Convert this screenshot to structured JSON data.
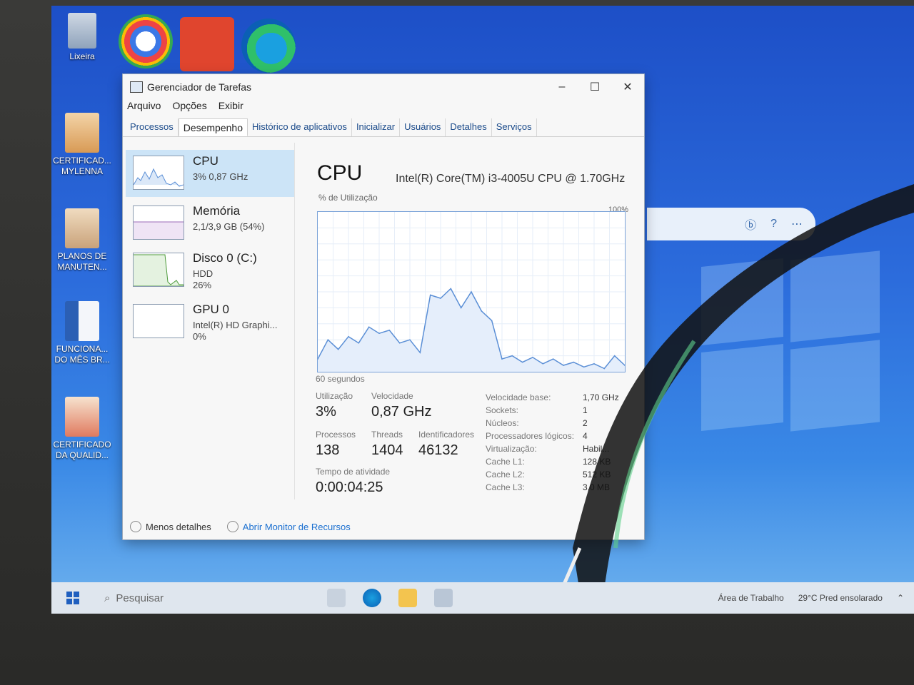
{
  "desktop": {
    "top_icon_labels": [
      "Lixeira"
    ],
    "icons": [
      {
        "label": "CERTIFICAD... MYLENNA"
      },
      {
        "label": "PLANOS DE MANUTEN..."
      },
      {
        "label": "FUNCIONA... DO MÊS BR..."
      },
      {
        "label": "CERTIFICADO DA QUALID..."
      }
    ]
  },
  "window": {
    "title": "Gerenciador de Tarefas",
    "controls": {
      "minimize": "–",
      "maximize": "☐",
      "close": "✕"
    },
    "menu": [
      "Arquivo",
      "Opções",
      "Exibir"
    ],
    "tabs": [
      "Processos",
      "Desempenho",
      "Histórico de aplicativos",
      "Inicializar",
      "Usuários",
      "Detalhes",
      "Serviços"
    ],
    "active_tab": "Desempenho"
  },
  "perf_items": [
    {
      "name": "CPU",
      "line1": "3% 0,87 GHz",
      "line2": "",
      "line3": ""
    },
    {
      "name": "Memória",
      "line1": "2,1/3,9 GB (54%)",
      "line2": "",
      "line3": ""
    },
    {
      "name": "Disco 0 (C:)",
      "line1": "HDD",
      "line2": "26%",
      "line3": ""
    },
    {
      "name": "GPU 0",
      "line1": "Intel(R) HD Graphi...",
      "line2": "0%",
      "line3": ""
    }
  ],
  "cpu": {
    "title": "CPU",
    "model": "Intel(R) Core(TM) i3-4005U CPU @ 1.70GHz",
    "graph_label": "% de Utilização",
    "graph_max": "100%",
    "graph_foot": "60 segundos",
    "stats": {
      "utilizacao_label": "Utilização",
      "utilizacao": "3%",
      "velocidade_label": "Velocidade",
      "velocidade": "0,87 GHz",
      "processos_label": "Processos",
      "processos": "138",
      "threads_label": "Threads",
      "threads": "1404",
      "ident_label": "Identificadores",
      "ident": "46132",
      "tempo_label": "Tempo de atividade",
      "tempo": "0:00:04:25"
    },
    "specs": [
      {
        "label": "Velocidade base:",
        "value": "1,70 GHz"
      },
      {
        "label": "Sockets:",
        "value": "1"
      },
      {
        "label": "Núcleos:",
        "value": "2"
      },
      {
        "label": "Processadores lógicos:",
        "value": "4"
      },
      {
        "label": "Virtualização:",
        "value": "Habil..."
      },
      {
        "label": "Cache L1:",
        "value": "128 KB"
      },
      {
        "label": "Cache L2:",
        "value": "512 KB"
      },
      {
        "label": "Cache L3:",
        "value": "3,0 MB"
      }
    ]
  },
  "footer": {
    "less": "Menos detalhes",
    "monitor": "Abrir Monitor de Recursos"
  },
  "taskbar": {
    "search_placeholder": "Pesquisar",
    "desktop_label": "Área de Trabalho",
    "weather": "29°C  Pred ensolarado"
  },
  "chart_data": {
    "type": "line",
    "title": "",
    "ylabel": "% de Utilização",
    "ylim": [
      0,
      100
    ],
    "x": [
      0,
      2,
      4,
      6,
      8,
      10,
      12,
      14,
      16,
      18,
      20,
      22,
      24,
      26,
      28,
      30,
      32,
      34,
      36,
      38,
      40,
      42,
      44,
      46,
      48,
      50,
      52,
      54,
      56,
      58,
      60
    ],
    "series": [
      {
        "name": "",
        "values": [
          8,
          20,
          14,
          22,
          18,
          28,
          24,
          26,
          18,
          20,
          12,
          48,
          46,
          52,
          40,
          50,
          38,
          32,
          8,
          10,
          6,
          9,
          5,
          8,
          4,
          6,
          3,
          5,
          2,
          10,
          4
        ]
      }
    ]
  },
  "colors": {
    "accent": "#1a6fd0",
    "selected": "#cce4f7",
    "graph_line": "#5b8fd6",
    "graph_fill": "#e5eefb"
  }
}
